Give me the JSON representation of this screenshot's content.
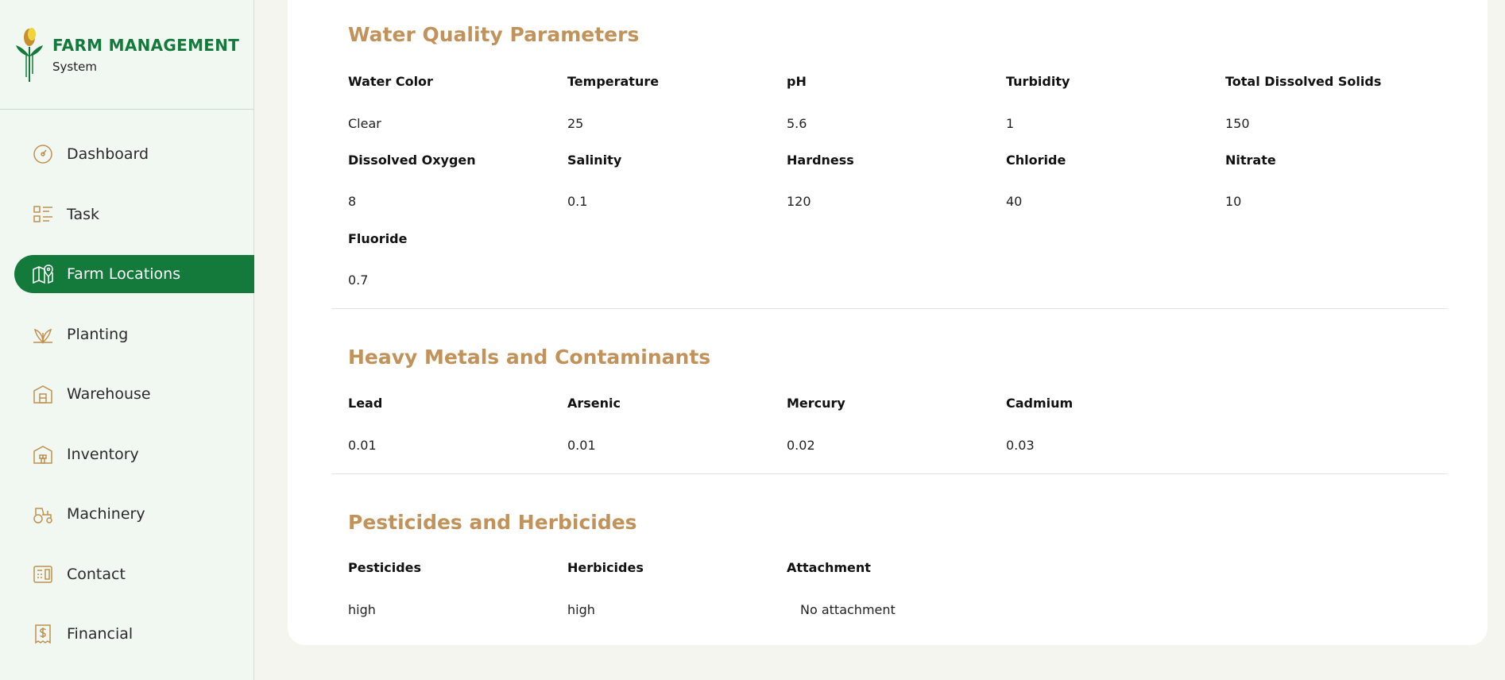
{
  "brand": {
    "title": "FARM MANAGEMENT",
    "subtitle": "System"
  },
  "sidebar": {
    "items": [
      {
        "label": "Dashboard",
        "icon": "gauge-icon"
      },
      {
        "label": "Task",
        "icon": "task-list-icon"
      },
      {
        "label": "Farm Locations",
        "icon": "map-pin-icon",
        "active": true
      },
      {
        "label": "Planting",
        "icon": "sprout-icon"
      },
      {
        "label": "Warehouse",
        "icon": "warehouse-icon"
      },
      {
        "label": "Inventory",
        "icon": "inventory-icon"
      },
      {
        "label": "Machinery",
        "icon": "tractor-icon"
      },
      {
        "label": "Contact",
        "icon": "contact-icon"
      },
      {
        "label": "Financial",
        "icon": "receipt-dollar-icon"
      }
    ]
  },
  "water_quality": {
    "title": "Water Quality Parameters",
    "fields": [
      {
        "label": "Water Color",
        "value": "Clear"
      },
      {
        "label": "Temperature",
        "value": "25"
      },
      {
        "label": "pH",
        "value": "5.6"
      },
      {
        "label": "Turbidity",
        "value": "1"
      },
      {
        "label": "Total Dissolved Solids",
        "value": "150"
      },
      {
        "label": "Dissolved Oxygen",
        "value": "8"
      },
      {
        "label": "Salinity",
        "value": "0.1"
      },
      {
        "label": "Hardness",
        "value": "120"
      },
      {
        "label": "Chloride",
        "value": "40"
      },
      {
        "label": "Nitrate",
        "value": "10"
      },
      {
        "label": "Fluoride",
        "value": "0.7"
      }
    ]
  },
  "heavy_metals": {
    "title": "Heavy Metals and Contaminants",
    "fields": [
      {
        "label": "Lead",
        "value": "0.01"
      },
      {
        "label": "Arsenic",
        "value": "0.01"
      },
      {
        "label": "Mercury",
        "value": "0.02"
      },
      {
        "label": "Cadmium",
        "value": "0.03"
      }
    ]
  },
  "pesticides": {
    "title": "Pesticides and Herbicides",
    "fields": [
      {
        "label": "Pesticides",
        "value": "high"
      },
      {
        "label": "Herbicides",
        "value": "high"
      },
      {
        "label": "Attachment",
        "value": "No attachment"
      }
    ]
  },
  "colors": {
    "brand_green": "#137a3c",
    "accent_tan": "#c1925a",
    "sidebar_bg": "#f1f8f2"
  }
}
